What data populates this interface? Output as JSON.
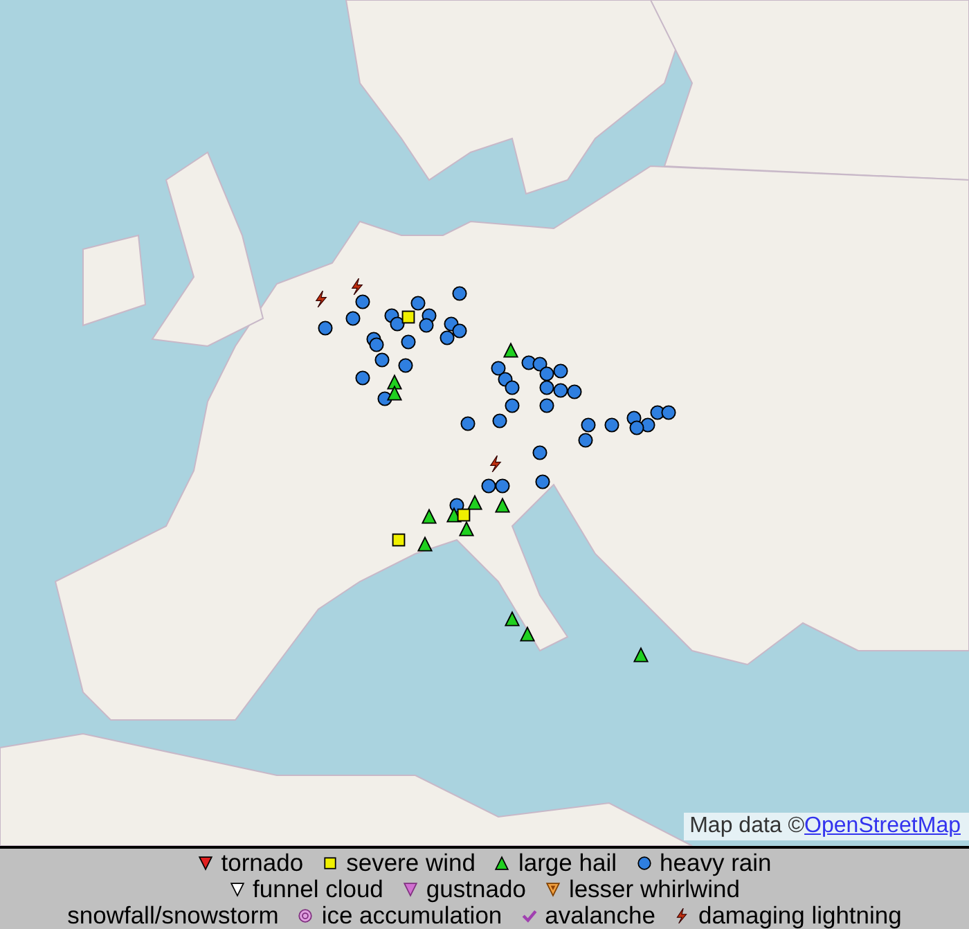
{
  "attribution": {
    "prefix": "Map data © ",
    "link": "OpenStreetMap"
  },
  "legend": {
    "rows": [
      {
        "items": [
          {
            "kind": "tornado",
            "label": "tornado"
          },
          {
            "kind": "wind",
            "label": "severe wind"
          },
          {
            "kind": "hail",
            "label": "large hail"
          },
          {
            "kind": "rain",
            "label": "heavy rain"
          }
        ]
      },
      {
        "items": [
          {
            "kind": "funnel",
            "label": "funnel cloud"
          },
          {
            "kind": "gustnado",
            "label": "gustnado"
          },
          {
            "kind": "whirlwind",
            "label": "lesser whirlwind"
          }
        ]
      },
      {
        "items": [
          {
            "kind": "snow",
            "label": "snowfall/snowstorm"
          },
          {
            "kind": "ice",
            "label": "ice accumulation"
          },
          {
            "kind": "avalanche",
            "label": "avalanche"
          },
          {
            "kind": "lightning",
            "label": "damaging lightning"
          }
        ]
      }
    ]
  }
}
